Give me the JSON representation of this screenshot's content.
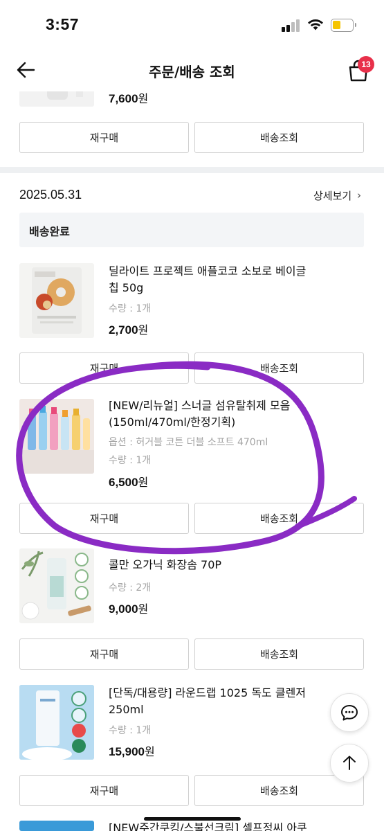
{
  "status_bar": {
    "time": "3:57"
  },
  "header": {
    "title": "주문/배송 조회",
    "cart_count": "13"
  },
  "prev_order": {
    "last_item_price": "7,600",
    "reorder_label": "재구매",
    "tracking_label": "배송조회"
  },
  "order": {
    "date": "2025.05.31",
    "detail_label": "상세보기",
    "status": "배송완료",
    "items": [
      {
        "name": "딜라이트 프로젝트 애플코코 소보로 베이글칩 50g",
        "name_line1": "딜라이트 프로젝트 애플코코 소보로 베이글",
        "name_line2": "칩 50g",
        "qty": "수량 : 1개",
        "price": "2,700",
        "reorder_label": "재구매",
        "tracking_label": "배송조회"
      },
      {
        "name_line1": "[NEW/리뉴얼] 스너글 섬유탈취제 모음",
        "name_line2": "(150ml/470ml/한정기획)",
        "option": "옵션 : 허거블 코튼 더블 소프트 470ml",
        "qty": "수량 : 1개",
        "price": "6,500",
        "reorder_label": "재구매",
        "tracking_label": "배송조회"
      },
      {
        "name_line1": "콜만 오가닉 화장솜 70P",
        "qty": "수량 : 2개",
        "price": "9,000",
        "reorder_label": "재구매",
        "tracking_label": "배송조회"
      },
      {
        "name_line1": "[단독/대용량] 라운드랩 1025 독도 클렌저",
        "name_line2": "250ml",
        "qty": "수량 : 1개",
        "price": "15,900",
        "reorder_label": "재구매",
        "tracking_label": "배송조회"
      },
      {
        "name_line1": "[NEW주간쿠킹/스불선크림] 셀프정씨 아쿠"
      }
    ]
  },
  "currency": "원",
  "colors": {
    "badge": "#e8304a",
    "annotation": "#8a2bc4",
    "divider": "#eef0f2"
  },
  "icons": [
    "back-arrow-icon",
    "shopping-bag-icon",
    "chat-icon",
    "arrow-up-icon"
  ]
}
